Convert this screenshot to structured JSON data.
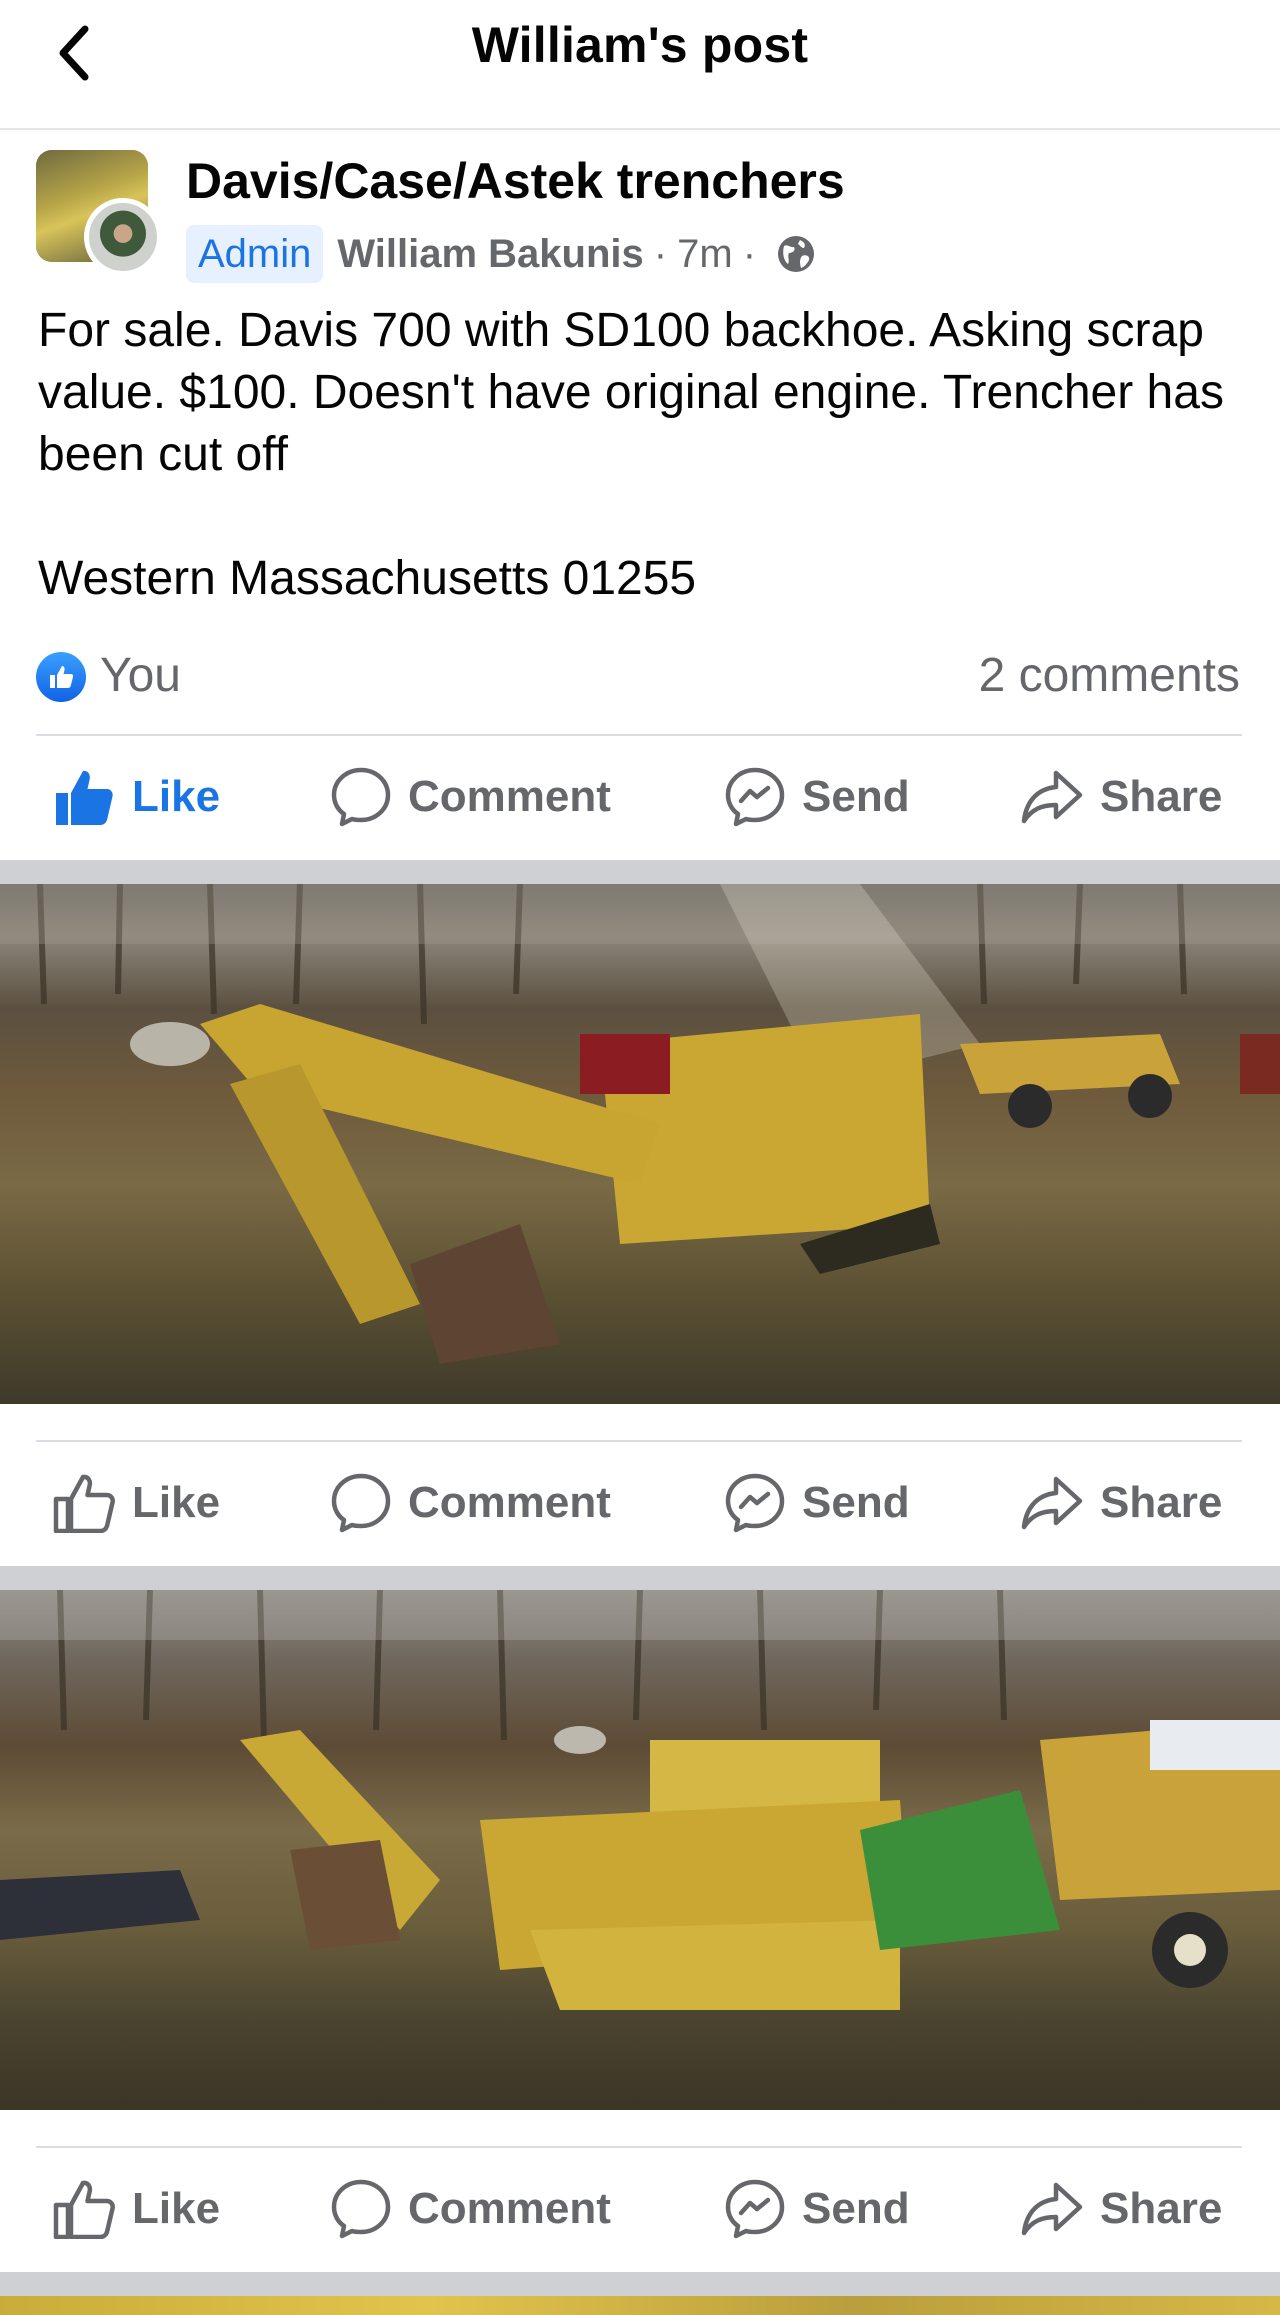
{
  "header": {
    "title": "William's post"
  },
  "post": {
    "group_name": "Davis/Case/Astek trenchers",
    "admin_badge": "Admin",
    "author": "William Bakunis",
    "time": "7m",
    "sep": "·",
    "body": "For sale. Davis 700 with SD100 backhoe. Asking scrap value. $100. Doesn't have original engine. Trencher has been cut off\n\nWestern Massachusetts 01255",
    "reaction_name": "You",
    "comments_count": "2 comments"
  },
  "actions": {
    "like": "Like",
    "comment": "Comment",
    "send": "Send",
    "share": "Share"
  },
  "colors": {
    "accent": "#1b74e4",
    "secondary_text": "#65676b",
    "separator": "#ced0d4"
  },
  "icons": [
    "back-arrow-icon",
    "globe-icon",
    "thumbs-up-icon",
    "comment-bubble-icon",
    "messenger-icon",
    "share-arrow-icon"
  ]
}
